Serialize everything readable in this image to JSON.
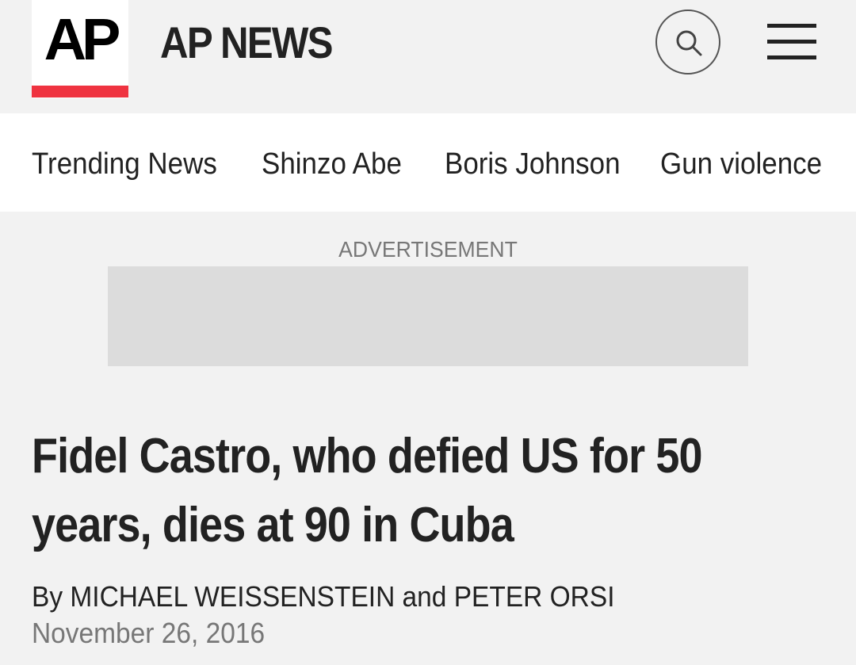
{
  "header": {
    "logo_text": "AP",
    "brand_name": "AP NEWS",
    "search_icon": "search-icon",
    "menu_icon": "hamburger-menu-icon",
    "accent_color": "#ef3340"
  },
  "trending": {
    "items": [
      {
        "label": "Trending News"
      },
      {
        "label": "Shinzo Abe"
      },
      {
        "label": "Boris Johnson"
      },
      {
        "label": "Gun violence"
      }
    ]
  },
  "ad": {
    "label": "ADVERTISEMENT"
  },
  "article": {
    "headline": "Fidel Castro, who defied US for 50 years, dies at 90 in Cuba",
    "byline": "By MICHAEL WEISSENSTEIN and PETER ORSI",
    "date": "November 26, 2016"
  }
}
